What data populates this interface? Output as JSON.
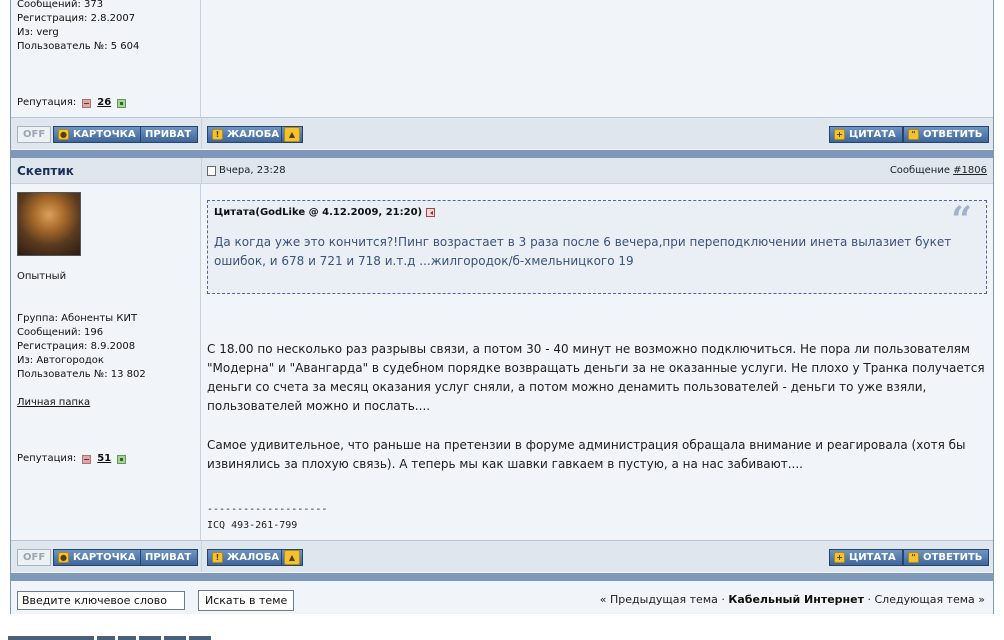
{
  "post1": {
    "info": [
      "Сообщений: 373",
      "Регистрация: 2.8.2007",
      "Из: verg",
      "Пользователь №: 5 604"
    ],
    "reputation_label": "Репутация:",
    "reputation_value": "26"
  },
  "buttons": {
    "off": "OFF",
    "card": "КАРТОЧКА",
    "private": "ПРИВАТ",
    "complaint": "ЖАЛОБА",
    "quote": "ЦИТАТА",
    "reply": "ОТВЕТИТЬ"
  },
  "post2": {
    "author": "Скептик",
    "date": "Вчера, 23:28",
    "msg_label": "Сообщение",
    "msg_num": "#1806",
    "rank": "Опытный",
    "info": [
      "Группа: Абоненты КИТ",
      "Сообщений: 196",
      "Регистрация: 8.9.2008",
      "Из: Автогородок",
      "Пользователь №: 13 802"
    ],
    "personal_folder": "Личная папка",
    "reputation_label": "Репутация:",
    "reputation_value": "51",
    "quote_title": "Цитата(GodLike @ 4.12.2009, 21:20)",
    "quote_text": "Да когда уже это кончится?!Пинг возрастает в 3 раза после 6 вечера,при переподключении инета вылазиет букет ошибок, и 678 и 721 и 718 и.т.д ...жилгородок/б-хмельницкого 19",
    "paragraph1": "С 18.00 по несколько раз разрывы связи, а потом 30 - 40 минут не возможно подключиться. Не пора ли пользователям \"Модерна\" и \"Авангарда\" в судебном порядке возвращать деньги за не оказанные услуги. Не плохо у Транка получается деньги со счета за месяц оказания услуг сняли, а потом можно денамить пользователей - деньги то уже взяли, пользователей можно и послать....",
    "paragraph2": "Самое удивительное, что раньше на претензии в форуме администрация обращала внимание и реагировала (хотя бы извинялись за плохую связь). А теперь мы как шавки гавкаем в пустую, а на нас забивают....",
    "sig_line": "--------------------",
    "sig_text": "ICQ 493-261-799"
  },
  "search": {
    "input_value": "Введите ключевое слово",
    "button": "Искать в теме"
  },
  "topicnav": {
    "prev": "« Предыдущая тема",
    "current": "Кабельный Интернет",
    "next": "Следующая тема »",
    "dot": "·"
  }
}
